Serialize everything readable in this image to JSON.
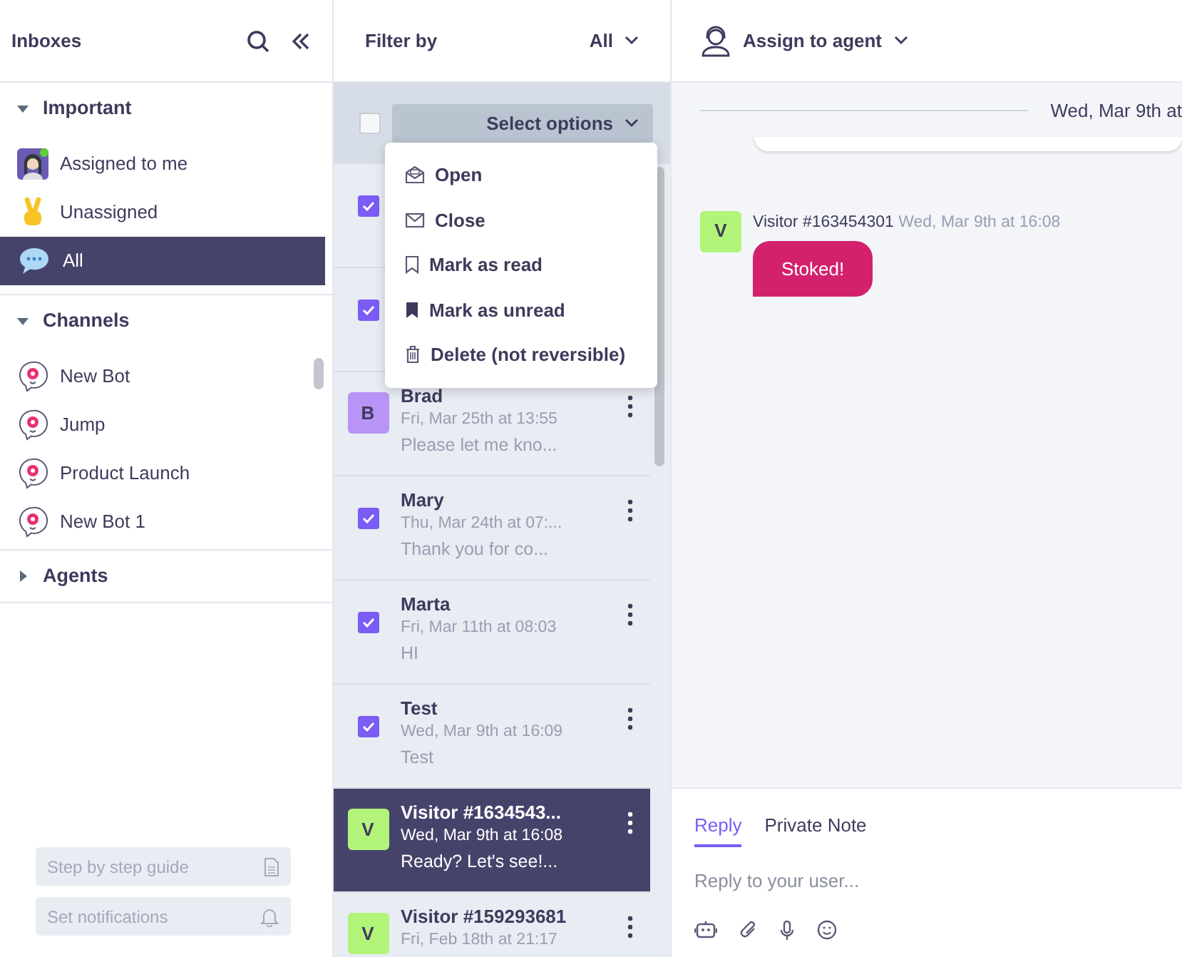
{
  "sidebar": {
    "title": "Inboxes",
    "sections": [
      {
        "label": "Important",
        "expanded": true,
        "items": [
          {
            "label": "Assigned to me",
            "online": true,
            "selected": false
          },
          {
            "label": "Unassigned",
            "selected": false
          },
          {
            "label": "All",
            "selected": true
          }
        ]
      },
      {
        "label": "Channels",
        "expanded": true,
        "items": [
          {
            "label": "New Bot",
            "selected": false
          },
          {
            "label": "Jump",
            "selected": false
          },
          {
            "label": "Product Launch",
            "selected": false
          },
          {
            "label": "New Bot 1",
            "selected": false
          }
        ]
      },
      {
        "label": "Agents",
        "expanded": false
      }
    ],
    "footer_buttons": [
      {
        "label": "Step by step guide"
      },
      {
        "label": "Set notifications"
      }
    ]
  },
  "list": {
    "filter_label": "Filter by",
    "filter_value": "All",
    "select_all_checked": false,
    "select_button": "Select options",
    "menu": [
      {
        "label": "Open"
      },
      {
        "label": "Close"
      },
      {
        "label": "Mark as read"
      },
      {
        "label": "Mark as unread"
      },
      {
        "label": "Delete (not reversible)"
      }
    ],
    "conversations": [
      {
        "kind": "checkbox",
        "checked": true
      },
      {
        "kind": "checkbox",
        "checked": true
      },
      {
        "kind": "avatar",
        "letter": "B",
        "color": "#b794f6",
        "name": "Brad",
        "time": "Fri, Mar 25th at 13:55",
        "preview": "Please let me kno...",
        "selected": false
      },
      {
        "kind": "checkbox",
        "checked": true,
        "name": "Mary",
        "time": "Thu, Mar 24th at 07:...",
        "preview": "Thank you for co...",
        "selected": false
      },
      {
        "kind": "checkbox",
        "checked": true,
        "name": "Marta",
        "time": "Fri, Mar 11th at 08:03",
        "preview": "HI",
        "selected": false
      },
      {
        "kind": "checkbox",
        "checked": true,
        "name": "Test",
        "time": "Wed, Mar 9th at 16:09",
        "preview": "Test",
        "selected": false
      },
      {
        "kind": "avatar",
        "letter": "V",
        "color": "#b2f47a",
        "name": "Visitor #1634543...",
        "time": "Wed, Mar 9th at 16:08",
        "preview": "Ready? Let's see!...",
        "selected": true
      },
      {
        "kind": "avatar",
        "letter": "V",
        "color": "#b2f47a",
        "name": "Visitor #159293681",
        "time": "Fri, Feb 18th at 21:17",
        "selected": false
      }
    ]
  },
  "chat": {
    "assign_label": "Assign to agent",
    "date_divider": "Wed, Mar 9th at",
    "message": {
      "avatar_letter": "V",
      "sender": "Visitor #163454301",
      "time": "Wed, Mar 9th at 16:08",
      "text": "Stoked!"
    },
    "composer": {
      "tabs": [
        {
          "label": "Reply",
          "selected": true
        },
        {
          "label": "Private Note",
          "selected": false
        }
      ],
      "placeholder": "Reply to your user..."
    }
  }
}
